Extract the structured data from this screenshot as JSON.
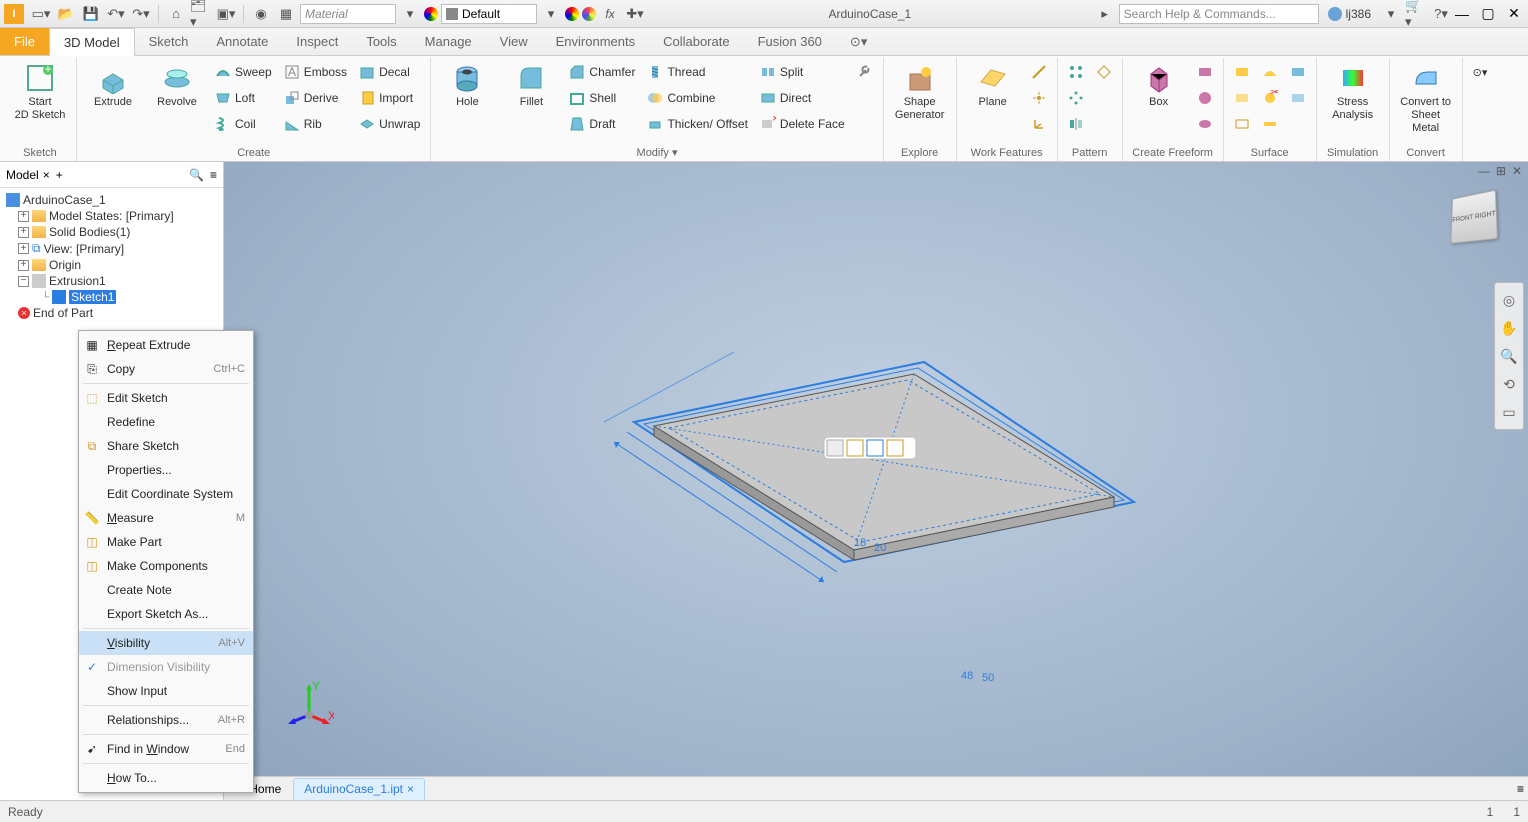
{
  "app": {
    "title": "ArduinoCase_1",
    "user": "lj386"
  },
  "search": {
    "placeholder": "Search Help & Commands..."
  },
  "material": {
    "placeholder": "Material",
    "appearance": "Default"
  },
  "tabs": {
    "file": "File",
    "items": [
      "3D Model",
      "Sketch",
      "Annotate",
      "Inspect",
      "Tools",
      "Manage",
      "View",
      "Environments",
      "Collaborate",
      "Fusion 360"
    ]
  },
  "ribbon": {
    "sketch": {
      "label": "Sketch",
      "start": "Start\n2D Sketch"
    },
    "create": {
      "label": "Create",
      "extrude": "Extrude",
      "revolve": "Revolve",
      "sweep": "Sweep",
      "loft": "Loft",
      "coil": "Coil",
      "emboss": "Emboss",
      "derive": "Derive",
      "rib": "Rib",
      "decal": "Decal",
      "import": "Import",
      "unwrap": "Unwrap"
    },
    "modify": {
      "label": "Modify ▾",
      "hole": "Hole",
      "fillet": "Fillet",
      "chamfer": "Chamfer",
      "shell": "Shell",
      "draft": "Draft",
      "thread": "Thread",
      "combine": "Combine",
      "thicken": "Thicken/ Offset",
      "split": "Split",
      "direct": "Direct",
      "deleteface": "Delete Face"
    },
    "explore": {
      "label": "Explore",
      "shape": "Shape\nGenerator"
    },
    "workfeat": {
      "label": "Work Features",
      "plane": "Plane"
    },
    "pattern": {
      "label": "Pattern"
    },
    "freeform": {
      "label": "Create Freeform",
      "box": "Box"
    },
    "surface": {
      "label": "Surface"
    },
    "simulation": {
      "label": "Simulation",
      "stress": "Stress\nAnalysis"
    },
    "convert": {
      "label": "Convert",
      "sheetmetal": "Convert to\nSheet Metal"
    }
  },
  "browser": {
    "tab": "Model",
    "root": "ArduinoCase_1",
    "states": "Model States: [Primary]",
    "solids": "Solid Bodies(1)",
    "view": "View: [Primary]",
    "origin": "Origin",
    "extrusion": "Extrusion1",
    "sketch": "Sketch1",
    "eop": "End of Part"
  },
  "cmenu": {
    "repeat": "Repeat Extrude",
    "copy": "Copy",
    "copySc": "Ctrl+C",
    "edit": "Edit Sketch",
    "redefine": "Redefine",
    "share": "Share Sketch",
    "props": "Properties...",
    "ecs": "Edit Coordinate System",
    "measure": "Measure",
    "measureSc": "M",
    "makepart": "Make Part",
    "makecomp": "Make Components",
    "createnote": "Create Note",
    "export": "Export Sketch As...",
    "visibility": "Visibility",
    "visSc": "Alt+V",
    "dimvis": "Dimension Visibility",
    "showinput": "Show Input",
    "relations": "Relationships...",
    "relSc": "Alt+R",
    "find": "Find in Window",
    "findSc": "End",
    "howto": "How To..."
  },
  "dims": {
    "w1": "48",
    "w2": "50",
    "h1": "18",
    "h2": "20"
  },
  "doctabs": {
    "home": "Home",
    "active": "ArduinoCase_1.ipt"
  },
  "status": {
    "ready": "Ready",
    "n1": "1",
    "n2": "1"
  }
}
